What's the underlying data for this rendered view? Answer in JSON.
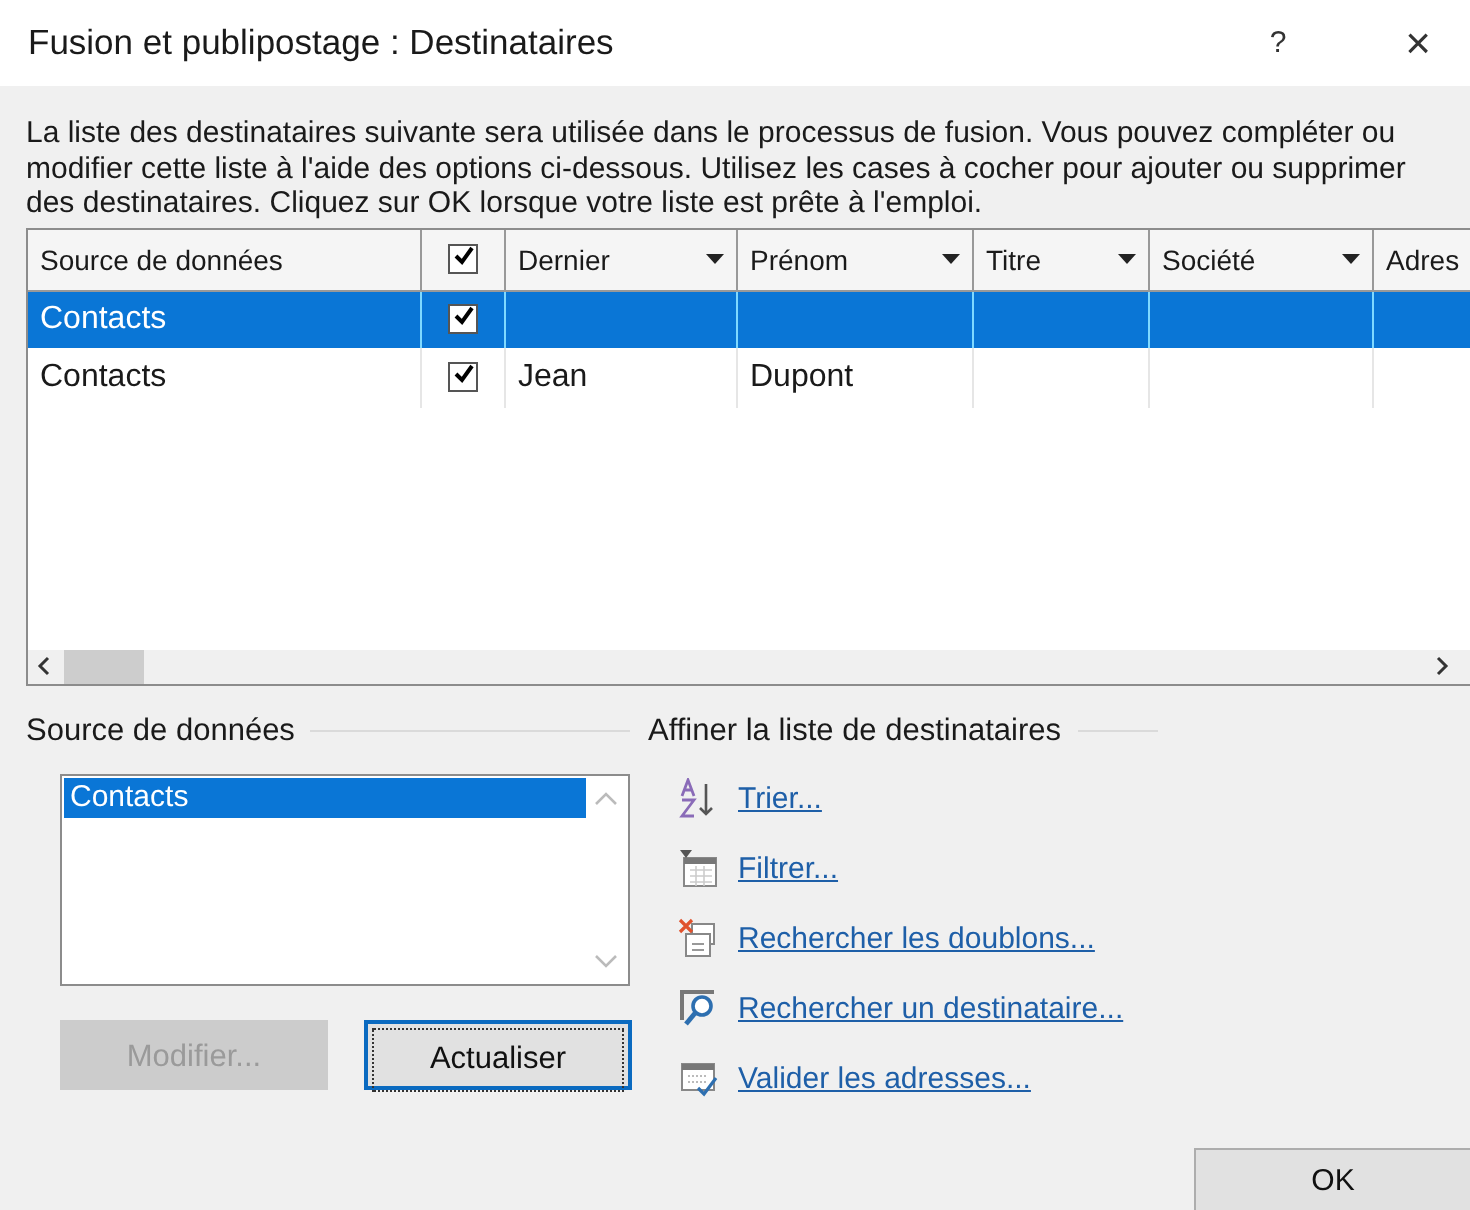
{
  "window": {
    "title": "Fusion et publipostage : Destinataires",
    "help": "?",
    "close": "×"
  },
  "intro": "La liste des destinataires suivante sera utilisée dans le processus de fusion. Vous pouvez compléter ou modifier cette liste à l'aide des options ci-dessous. Utilisez les cases à cocher pour ajouter ou supprimer des destinataires. Cliquez sur OK lorsque votre liste est prête à l'emploi.",
  "table": {
    "columns": [
      {
        "kind": "text",
        "label": "Source de données",
        "filter": false
      },
      {
        "kind": "checkbox",
        "checked": true
      },
      {
        "kind": "text",
        "label": "Dernier",
        "filter": true
      },
      {
        "kind": "text",
        "label": "Prénom",
        "filter": true
      },
      {
        "kind": "text",
        "label": "Titre",
        "filter": true
      },
      {
        "kind": "text",
        "label": "Société",
        "filter": true
      },
      {
        "kind": "text",
        "label": "Adres"
      }
    ],
    "rows": [
      {
        "selected": true,
        "checked": true,
        "cells": [
          "Contacts",
          "",
          "",
          "",
          "",
          "",
          ""
        ]
      },
      {
        "selected": false,
        "checked": true,
        "cells": [
          "Contacts",
          "",
          "Jean",
          "Dupont",
          "",
          "",
          ""
        ]
      }
    ]
  },
  "data_source": {
    "title": "Source de données",
    "items": [
      {
        "label": "Contacts",
        "selected": true
      }
    ],
    "buttons": [
      {
        "label": "Modifier...",
        "disabled": true,
        "focused": false
      },
      {
        "label": "Actualiser",
        "disabled": false,
        "focused": true
      }
    ]
  },
  "refine": {
    "title": "Affiner la liste de destinataires",
    "links": [
      {
        "kind": "sort",
        "label": "Trier..."
      },
      {
        "kind": "filter",
        "label": "Filtrer..."
      },
      {
        "kind": "duplicates",
        "label": "Rechercher les doublons..."
      },
      {
        "kind": "find",
        "label": "Rechercher un destinataire..."
      },
      {
        "kind": "validate",
        "label": "Valider les adresses..."
      }
    ]
  },
  "ok_button": "OK"
}
